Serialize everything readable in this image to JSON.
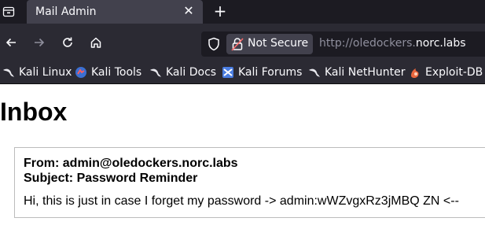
{
  "browser": {
    "tab": {
      "title": "Mail Admin",
      "close_glyph": "✕"
    },
    "new_tab_glyph": "+",
    "address": {
      "security_label": "Not Secure",
      "url_prefix": "http://oledockers.",
      "url_host": "norc.labs"
    },
    "bookmarks": [
      {
        "label": "Kali Linux",
        "icon": "kali-dragon-icon"
      },
      {
        "label": "Kali Tools",
        "icon": "kali-tools-icon"
      },
      {
        "label": "Kali Docs",
        "icon": "kali-dragon-icon"
      },
      {
        "label": "Kali Forums",
        "icon": "kali-forums-icon"
      },
      {
        "label": "Kali NetHunter",
        "icon": "kali-dragon-icon"
      },
      {
        "label": "Exploit-DB",
        "icon": "exploit-db-icon"
      }
    ]
  },
  "page": {
    "title": "Inbox",
    "email": {
      "from": "From: admin@oledockers.norc.labs",
      "subject": "Subject: Password Reminder",
      "body": "Hi, this is just in case I forget my password -> admin:wWZvgxRz3jMBQ ZN <--"
    }
  },
  "colors": {
    "chrome_dark": "#1c1b22",
    "chrome": "#2b2a33",
    "tab_active": "#42414d",
    "text_light": "#fbfbfe"
  }
}
